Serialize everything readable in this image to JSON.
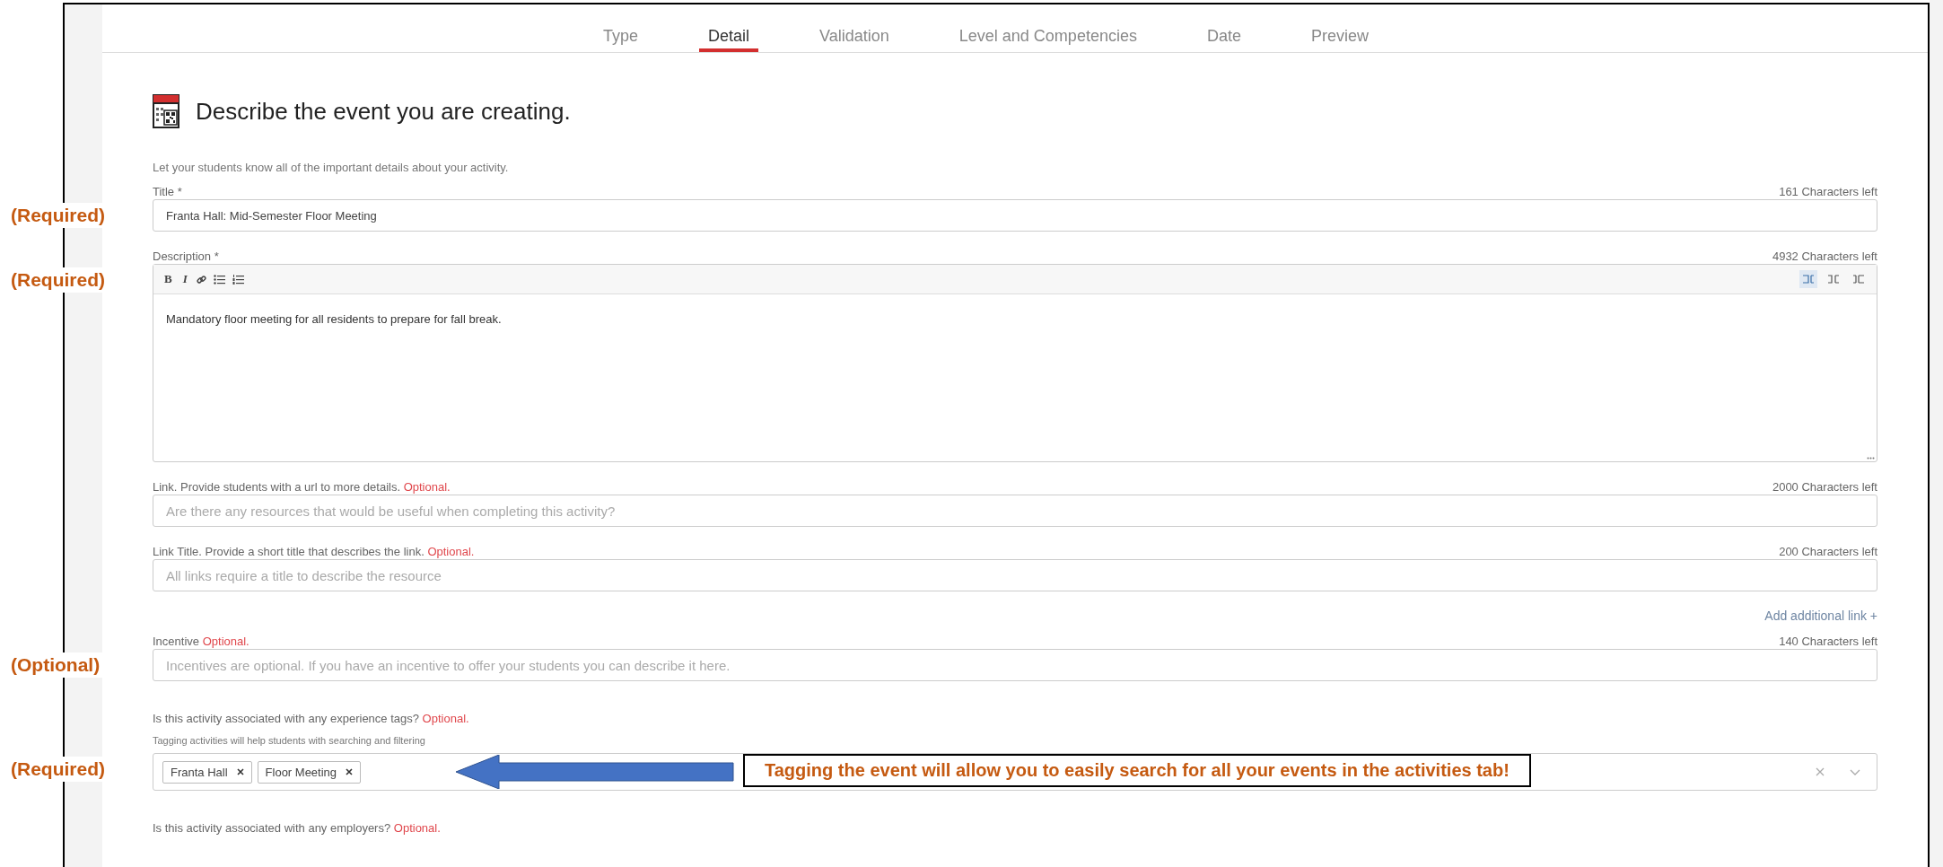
{
  "tabs": [
    {
      "label": "Type",
      "selected": false
    },
    {
      "label": "Detail",
      "selected": true
    },
    {
      "label": "Validation",
      "selected": false
    },
    {
      "label": "Level and Competencies",
      "selected": false
    },
    {
      "label": "Date",
      "selected": false
    },
    {
      "label": "Preview",
      "selected": false
    }
  ],
  "heading": {
    "title": "Describe the event you are creating.",
    "subtitle": "Let your students know all of the important details about your activity."
  },
  "fields": [
    {
      "kind": "text",
      "label": "Title *",
      "counter": "161 Characters left",
      "value": "Franta Hall: Mid-Semester Floor Meeting",
      "annotation": "(Required)"
    },
    {
      "kind": "rich",
      "label": "Description *",
      "counter": "4932 Characters left",
      "value": "Mandatory floor meeting for all residents to prepare for fall break.",
      "toolbar": [
        "B",
        "I"
      ],
      "direction_buttons": [
        {
          "selected": true
        },
        {
          "selected": false
        },
        {
          "selected": false
        }
      ],
      "annotation": "(Required)"
    },
    {
      "kind": "text",
      "label": "Link. Provide students with a url to more details.",
      "optional": "Optional.",
      "counter": "2000 Characters left",
      "placeholder": "Are there any resources that would be useful when completing this activity?"
    },
    {
      "kind": "text",
      "label": "Link Title. Provide a short title that describes the link.",
      "optional": "Optional.",
      "counter": "200 Characters left",
      "placeholder": "All links require a title to describe the resource"
    },
    {
      "kind": "action",
      "label": "Add additional link +"
    },
    {
      "kind": "text",
      "label": "Incentive",
      "optional": "Optional.",
      "counter": "140 Characters left",
      "placeholder": "Incentives are optional. If you have an incentive to offer your students you can describe it here.",
      "annotation": "(Optional)"
    },
    {
      "kind": "tags",
      "label": "Is this activity associated with any experience tags?",
      "optional": "Optional.",
      "hint": "Tagging activities will help students with searching and filtering",
      "tags": [
        "Franta Hall",
        "Floor Meeting"
      ],
      "annotation": "(Required)",
      "callout": "Tagging the event will allow you to easily search for all your events in the activities tab!"
    },
    {
      "kind": "question",
      "label": "Is this activity associated with any employers?",
      "optional": "Optional."
    }
  ]
}
